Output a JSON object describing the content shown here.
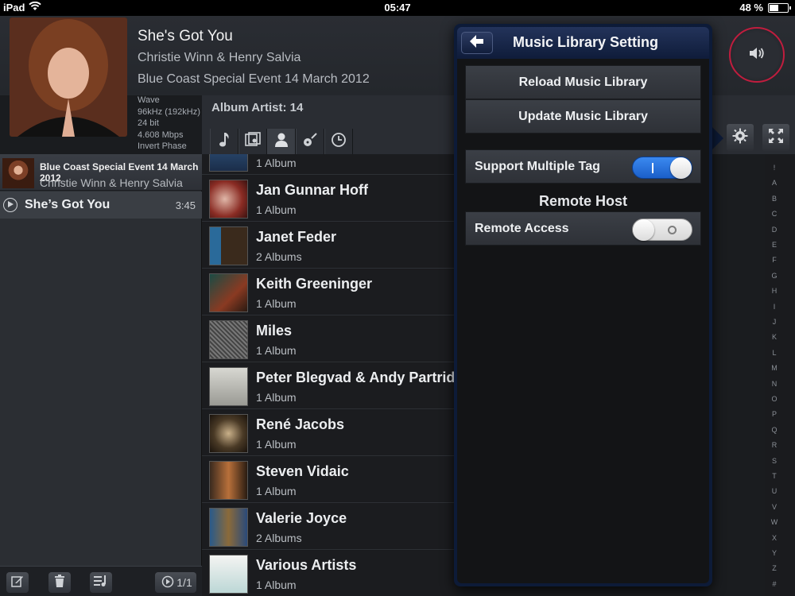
{
  "status": {
    "device": "iPad",
    "time": "05:47",
    "battery": "48 %",
    "battery_level": 0.48
  },
  "now_playing": {
    "title": "She's Got You",
    "artist": "Christie Winn & Henry Salvia",
    "album": "Blue Coast Special Event 14 March 2012",
    "meta": [
      "Wave",
      "96kHz (192kHz)",
      "24 bit",
      "4.608 Mbps",
      "Invert Phase"
    ]
  },
  "queue": {
    "album": "Blue Coast Special Event 14 March 2012",
    "artist": "Christie Winn & Henry Salvia",
    "track": {
      "name": "She’s Got You",
      "duration": "3:45"
    },
    "page": "1/1"
  },
  "library": {
    "header": "Album Artist: 14",
    "tabs": [
      "music-note-icon",
      "album-icon",
      "artist-icon",
      "genre-guitar-icon",
      "recent-clock-icon"
    ],
    "rows": [
      {
        "name": "",
        "count": "1 Album"
      },
      {
        "name": "Jan Gunnar Hoff",
        "count": "1 Album"
      },
      {
        "name": "Janet Feder",
        "count": "2 Albums"
      },
      {
        "name": "Keith Greeninger",
        "count": "1 Album"
      },
      {
        "name": "Miles",
        "count": "1 Album"
      },
      {
        "name": "Peter Blegvad & Andy Partridge",
        "count": "1 Album"
      },
      {
        "name": "René Jacobs",
        "count": "1 Album"
      },
      {
        "name": "Steven Vidaic",
        "count": "1 Album"
      },
      {
        "name": "Valerie Joyce",
        "count": "2 Albums"
      },
      {
        "name": "Various Artists",
        "count": "1 Album"
      }
    ]
  },
  "alpha_index": [
    "!",
    "A",
    "B",
    "C",
    "D",
    "E",
    "F",
    "G",
    "H",
    "I",
    "J",
    "K",
    "L",
    "M",
    "N",
    "O",
    "P",
    "Q",
    "R",
    "S",
    "T",
    "U",
    "V",
    "W",
    "X",
    "Y",
    "Z",
    "#"
  ],
  "settings": {
    "title": "Music Library Setting",
    "reload_label": "Reload Music Library",
    "update_label": "Update Music Library",
    "multiple_tag_label": "Support Multiple Tag",
    "multiple_tag_on": true,
    "remote_section": "Remote Host",
    "remote_access_label": "Remote Access",
    "remote_access_on": false
  },
  "colors": {
    "accent_red": "#c01d3e",
    "toggle_blue": "#1b5fc9",
    "popover_navy": "#0d1b38"
  }
}
